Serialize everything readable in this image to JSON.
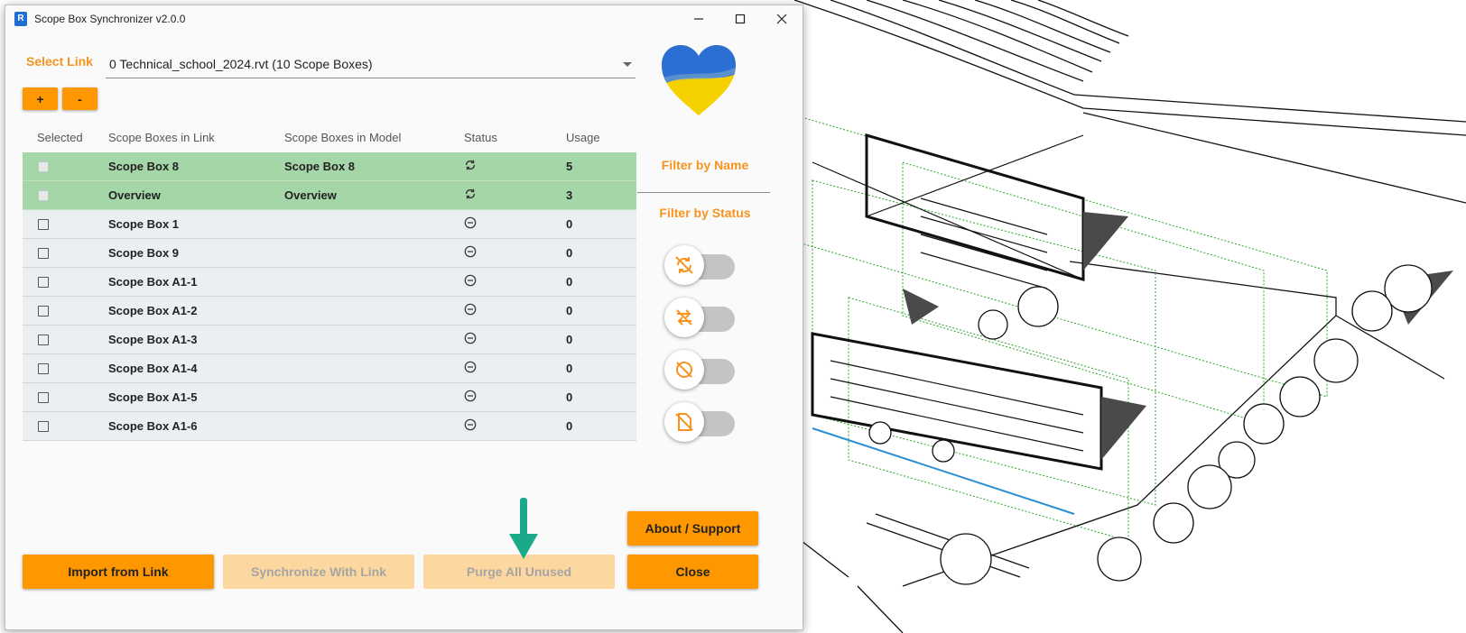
{
  "window": {
    "title": "Scope Box Synchronizer v2.0.0",
    "app_icon": "revit-r-icon",
    "controls": [
      "minimize-icon",
      "maximize-icon",
      "close-icon"
    ]
  },
  "link": {
    "label": "Select Link",
    "value": "0 Technical_school_2024.rvt (10 Scope Boxes)"
  },
  "add_label": "+",
  "remove_label": "-",
  "table": {
    "headers": [
      "Selected",
      "Scope Boxes in Link",
      "Scope Boxes in Model",
      "Status",
      "Usage"
    ],
    "rows": [
      {
        "checked": false,
        "disabled": true,
        "link": "Scope Box 8",
        "model": "Scope Box 8",
        "status_icon": "sync-icon",
        "usage": "5",
        "state": "synced"
      },
      {
        "checked": false,
        "disabled": true,
        "link": "Overview",
        "model": "Overview",
        "status_icon": "sync-icon",
        "usage": "3",
        "state": "synced"
      },
      {
        "checked": false,
        "disabled": false,
        "link": "Scope Box 1",
        "model": "",
        "status_icon": "minus-circle-icon",
        "usage": "0",
        "state": "unused"
      },
      {
        "checked": false,
        "disabled": false,
        "link": "Scope Box 9",
        "model": "",
        "status_icon": "minus-circle-icon",
        "usage": "0",
        "state": "unused"
      },
      {
        "checked": false,
        "disabled": false,
        "link": "Scope Box A1-1",
        "model": "",
        "status_icon": "minus-circle-icon",
        "usage": "0",
        "state": "unused"
      },
      {
        "checked": false,
        "disabled": false,
        "link": "Scope Box A1-2",
        "model": "",
        "status_icon": "minus-circle-icon",
        "usage": "0",
        "state": "unused"
      },
      {
        "checked": false,
        "disabled": false,
        "link": "Scope Box A1-3",
        "model": "",
        "status_icon": "minus-circle-icon",
        "usage": "0",
        "state": "unused"
      },
      {
        "checked": false,
        "disabled": false,
        "link": "Scope Box A1-4",
        "model": "",
        "status_icon": "minus-circle-icon",
        "usage": "0",
        "state": "unused"
      },
      {
        "checked": false,
        "disabled": false,
        "link": "Scope Box A1-5",
        "model": "",
        "status_icon": "minus-circle-icon",
        "usage": "0",
        "state": "unused"
      },
      {
        "checked": false,
        "disabled": false,
        "link": "Scope Box A1-6",
        "model": "",
        "status_icon": "minus-circle-icon",
        "usage": "0",
        "state": "unused"
      }
    ]
  },
  "filters": {
    "by_name": "Filter by Name",
    "by_status": "Filter by Status",
    "toggles": [
      {
        "icon": "sync-off-icon",
        "on": false
      },
      {
        "icon": "swap-icon",
        "on": false
      },
      {
        "icon": "sync-disabled-icon",
        "on": false
      },
      {
        "icon": "no-file-icon",
        "on": false
      }
    ]
  },
  "buttons": {
    "import": "Import from Link",
    "synchronize": "Synchronize With Link",
    "purge": "Purge All Unused",
    "about": "About / Support",
    "close": "Close"
  },
  "colors": {
    "accent": "#ff9800",
    "accent_text": "#f7931e",
    "synced_row": "#a5d6a7",
    "row_bg": "#eceff1",
    "arrow": "#1aaa8a",
    "heart_blue": "#2b6fd4",
    "heart_yellow": "#f5d100"
  },
  "background_icon": "revit-3d-building-view",
  "annotation_icon": "down-arrow-icon"
}
